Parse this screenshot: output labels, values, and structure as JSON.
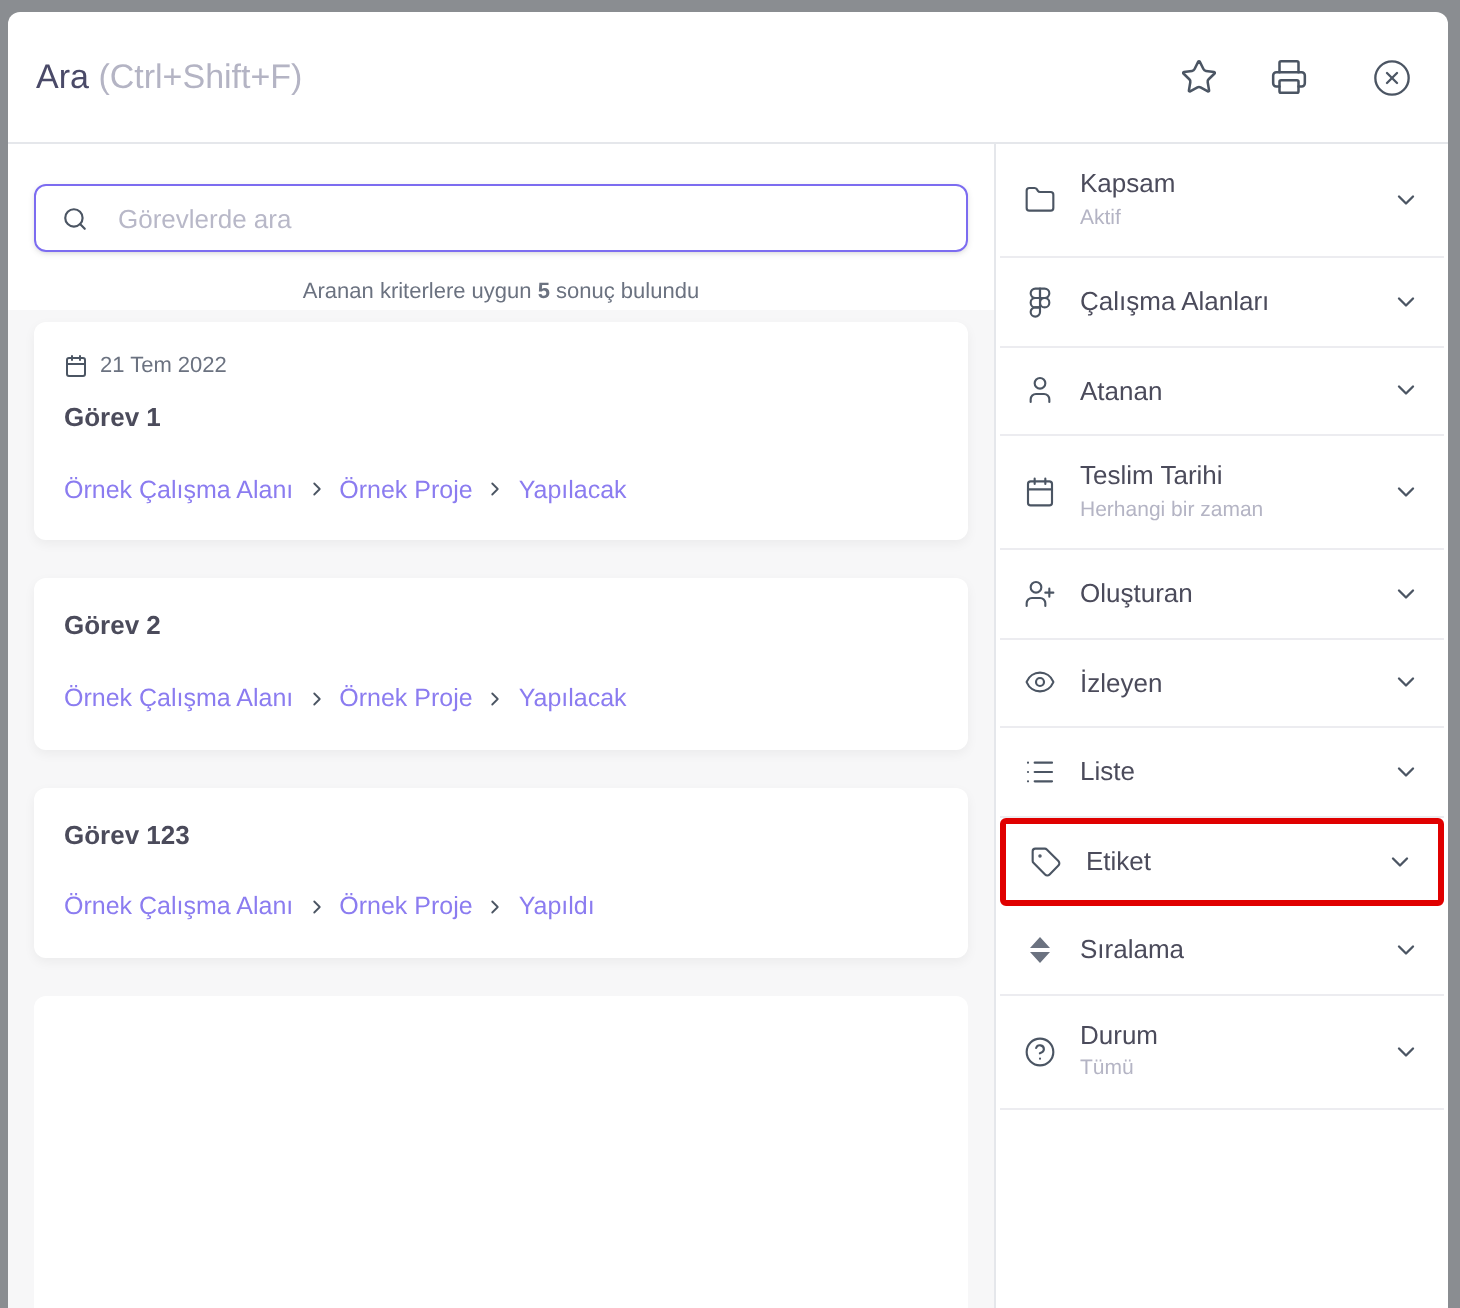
{
  "dialog": {
    "title": "Ara",
    "shortcut": "(Ctrl+Shift+F)"
  },
  "search": {
    "placeholder": "Görevlerde ara"
  },
  "result_summary": "Aranan kriterlere uygun **5** sonuç bulundu",
  "results": [
    {
      "date": "21 Tem 2022",
      "title": "Görev 1",
      "path": [
        "Örnek Çalışma Alanı",
        "Örnek Proje",
        "Yapılacak"
      ]
    },
    {
      "title": "Görev 2",
      "path": [
        "Örnek Çalışma Alanı",
        "Örnek Proje",
        "Yapılacak"
      ]
    },
    {
      "title": "Görev 123",
      "path": [
        "Örnek Çalışma Alanı",
        "Örnek Proje",
        "Yapıldı"
      ]
    }
  ],
  "filters": [
    {
      "label": "Kapsam",
      "value": "Aktif",
      "highlighted": false
    },
    {
      "label": "Çalışma Alanları",
      "highlighted": false
    },
    {
      "label": "Atanan",
      "highlighted": false
    },
    {
      "label": "Teslim Tarihi",
      "value": "Herhangi bir zaman",
      "highlighted": false
    },
    {
      "label": "Oluşturan",
      "highlighted": false
    },
    {
      "label": "İzleyen",
      "highlighted": false
    },
    {
      "label": "Liste",
      "highlighted": false
    },
    {
      "label": "Etiket",
      "highlighted": true
    },
    {
      "label": "Sıralama",
      "highlighted": false
    },
    {
      "label": "Durum",
      "value": "Tümü",
      "highlighted": false
    }
  ]
}
